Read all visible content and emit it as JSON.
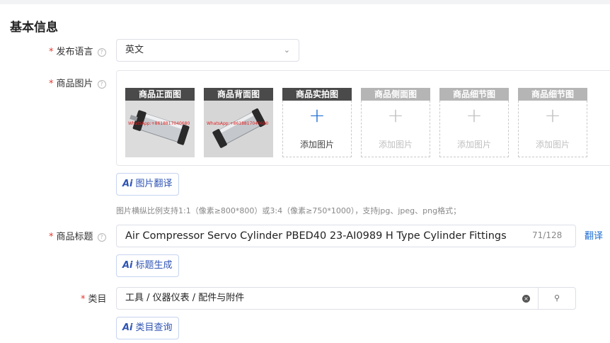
{
  "section": {
    "title": "基本信息"
  },
  "language": {
    "required_mark": "*",
    "label": "发布语言",
    "help": "?",
    "value": "英文",
    "chevron": "⌄"
  },
  "images": {
    "required_mark": "*",
    "label": "商品图片",
    "help": "?",
    "slots": [
      {
        "caption": "商品正面图",
        "state": "photo",
        "watermark": "WhatsApp:+8618817040680"
      },
      {
        "caption": "商品背面图",
        "state": "photo",
        "watermark": "WhatsApp:+8618817040680"
      },
      {
        "caption": "商品实拍图",
        "state": "active",
        "plus": "+",
        "add_label": "添加图片"
      },
      {
        "caption": "商品侧面图",
        "state": "dim",
        "plus": "+",
        "add_label": "添加图片"
      },
      {
        "caption": "商品细节图",
        "state": "dim",
        "plus": "+",
        "add_label": "添加图片"
      },
      {
        "caption": "商品细节图",
        "state": "dim",
        "plus": "+",
        "add_label": "添加图片"
      }
    ],
    "ai_icon": "Ai",
    "ai_button": "图片翻译",
    "hint": "图片横纵比例支持1:1（像素≥800*800）或3:4（像素≥750*1000），支持jpg、jpeg、png格式；"
  },
  "product_title": {
    "required_mark": "*",
    "label": "商品标题",
    "help": "?",
    "value": "Air Compressor Servo Cylinder PBED40 23-AI0989 H Type Cylinder Fittings",
    "counter": "71/128",
    "translate": "翻译",
    "ai_icon": "Ai",
    "ai_button": "标题生成"
  },
  "category": {
    "required_mark": "*",
    "label": "类目",
    "value": "工具 / 仪器仪表 / 配件与附件",
    "clear": "×",
    "search_icon": "⚲",
    "ai_icon": "Ai",
    "ai_button": "类目查询"
  },
  "icons": [
    "help-icon",
    "chevron-down-icon",
    "plus-icon",
    "ai-icon",
    "clear-icon",
    "search-icon"
  ],
  "colors": {
    "required": "#e5372b",
    "link": "#1f6ed4",
    "ai": "#2f54b4"
  }
}
